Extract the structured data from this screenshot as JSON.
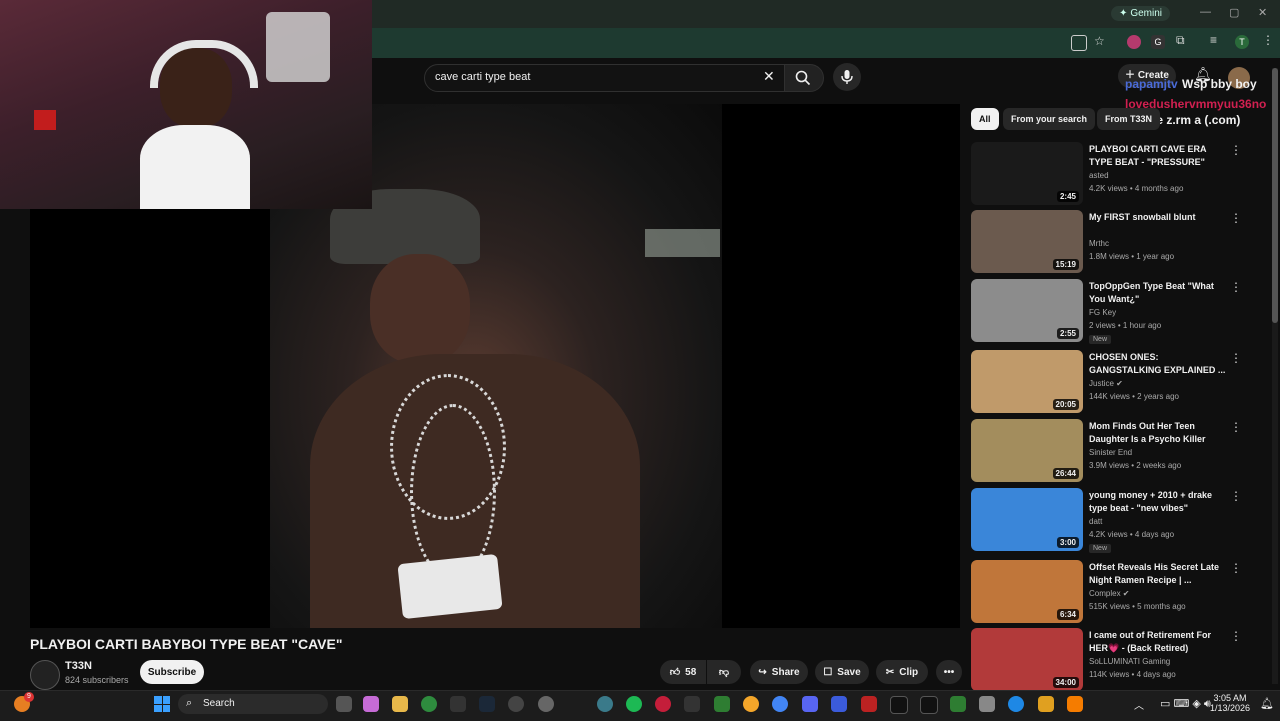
{
  "browser": {
    "gemini_label": "Gemini",
    "window_controls": [
      "—",
      "▢",
      "✕"
    ],
    "ext_labels": [
      "G",
      "T"
    ]
  },
  "youtube": {
    "search_value": "cave carti type beat",
    "create_label": "Create"
  },
  "overlay": {
    "chat_user_1": "papamjtv",
    "chat_message_1": "Wsp bby boy",
    "chat_user_2": "lovedushervmmyuu36no",
    "chat_message_2": "T33n e z.rm a (.com)"
  },
  "video": {
    "title": "PLAYBOI CARTI BABYBOI TYPE BEAT \"CAVE\"",
    "channel": "T33N",
    "subscribers": "824 subscribers",
    "subscribe_label": "Subscribe",
    "likes": "58",
    "share_label": "Share",
    "save_label": "Save",
    "clip_label": "Clip",
    "more_label": "•••"
  },
  "filters": [
    "All",
    "From your search",
    "From T33N"
  ],
  "recommendations": [
    {
      "title": "PLAYBOI CARTI CAVE ERA TYPE BEAT - \"PRESSURE\"",
      "channel": "asted",
      "meta": "4.2K views • 4 months ago",
      "duration": "2:45",
      "badge": "",
      "verified": false,
      "thumb": "#1a1a1a"
    },
    {
      "title": "My FIRST snowball blunt",
      "channel": "Mrthc",
      "meta": "1.8M views • 1 year ago",
      "duration": "15:19",
      "badge": "",
      "verified": false,
      "thumb": "#6b5a4e"
    },
    {
      "title": "TopOppGen Type Beat \"What You Want¿\"",
      "channel": "FG Key",
      "meta": "2 views • 1 hour ago",
      "duration": "2:55",
      "badge": "New",
      "verified": false,
      "thumb": "#8c8c8c"
    },
    {
      "title": "CHOSEN ONES: GANGSTALKING EXPLAINED ...",
      "channel": "Justice",
      "meta": "144K views • 2 years ago",
      "duration": "20:05",
      "badge": "",
      "verified": true,
      "thumb": "#c09a6a"
    },
    {
      "title": "Mom Finds Out Her Teen Daughter Is a Psycho Killer",
      "channel": "Sinister End",
      "meta": "3.9M views • 2 weeks ago",
      "duration": "26:44",
      "badge": "",
      "verified": false,
      "thumb": "#a38d5d"
    },
    {
      "title": "young money + 2010 + drake type beat - \"new vibes\"",
      "channel": "datt",
      "meta": "4.2K views • 4 days ago",
      "duration": "3:00",
      "badge": "New",
      "verified": false,
      "thumb": "#3a86d9"
    },
    {
      "title": "Offset Reveals His Secret Late Night Ramen Recipe | ...",
      "channel": "Complex",
      "meta": "515K views • 5 months ago",
      "duration": "6:34",
      "badge": "",
      "verified": true,
      "thumb": "#c0763a"
    },
    {
      "title": "I came out of Retirement For HER💗 - (Back Retired)",
      "channel": "SoLLUMINATI Gaming",
      "meta": "114K views • 4 days ago",
      "duration": "34:00",
      "badge": "",
      "verified": false,
      "thumb": "#b23a3a"
    }
  ],
  "taskbar": {
    "search_label": "Search",
    "time": "3:05 AM",
    "date": "1/13/2026",
    "notification_count": "9"
  }
}
